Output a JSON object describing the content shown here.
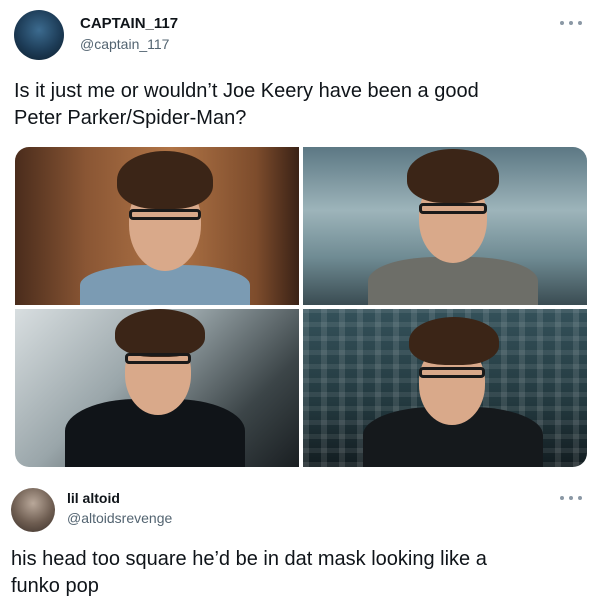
{
  "tweets": [
    {
      "display_name": "CAPTAIN_117",
      "handle": "@captain_117",
      "avatar_icon": "avatar-icon",
      "more_icon": "more-options-icon",
      "text": "Is it just me or wouldn’t Joe Keery have been a good\nPeter Parker/Spider-Man?",
      "media_count": 4
    },
    {
      "display_name": "lil altoid",
      "handle": "@altoidsrevenge",
      "avatar_icon": "avatar-icon",
      "more_icon": "more-options-icon",
      "text": "his head too square he’d be in dat mask looking like a\nfunko pop"
    }
  ],
  "colors": {
    "text_primary": "#0f1419",
    "text_secondary": "#536471",
    "background": "#ffffff"
  }
}
